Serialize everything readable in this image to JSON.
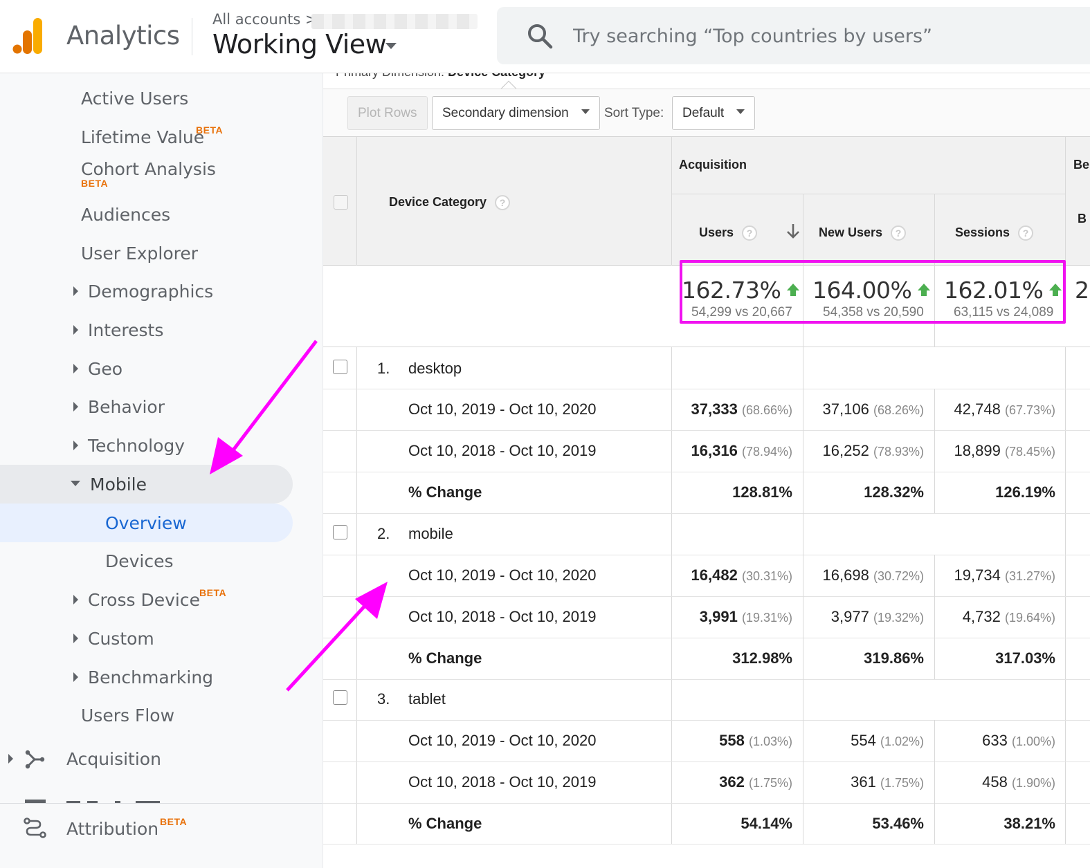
{
  "header": {
    "app_name": "Analytics",
    "breadcrumb": "All accounts",
    "view_name": "Working View",
    "search_placeholder": "Try searching “Top countries by users”"
  },
  "sidebar": {
    "items": [
      {
        "label": "Active Users"
      },
      {
        "label": "Lifetime Value",
        "badge": "BETA"
      },
      {
        "label": "Cohort Analysis",
        "badge": "BETA"
      },
      {
        "label": "Audiences"
      },
      {
        "label": "User Explorer"
      },
      {
        "label": "Demographics"
      },
      {
        "label": "Interests"
      },
      {
        "label": "Geo"
      },
      {
        "label": "Behavior"
      },
      {
        "label": "Technology"
      },
      {
        "label": "Mobile"
      },
      {
        "label": "Overview"
      },
      {
        "label": "Devices"
      },
      {
        "label": "Cross Device",
        "badge": "BETA"
      },
      {
        "label": "Custom"
      },
      {
        "label": "Benchmarking"
      },
      {
        "label": "Users Flow"
      },
      {
        "label": "Acquisition"
      },
      {
        "label": "Attribution",
        "badge": "BETA"
      }
    ]
  },
  "toolbar": {
    "primary_dimension_label": "Primary Dimension:",
    "primary_dimension_value": "Device Category",
    "plot_rows": "Plot Rows",
    "secondary_dimension": "Secondary dimension",
    "sort_type_label": "Sort Type:",
    "sort_type_value": "Default"
  },
  "table": {
    "dimension_header": "Device Category",
    "group_header": "Acquisition",
    "next_group_header_partial": "Be",
    "next_col_partial": "B",
    "columns": [
      "Users",
      "New Users",
      "Sessions"
    ],
    "totals": [
      {
        "pct": "162.73%",
        "compare": "54,299 vs 20,667"
      },
      {
        "pct": "164.00%",
        "compare": "54,358 vs 20,590"
      },
      {
        "pct": "162.01%",
        "compare": "63,115 vs 24,089"
      }
    ],
    "totals_partial_next": "2",
    "groups": [
      {
        "index": "1.",
        "name": "desktop",
        "rows": [
          {
            "label": "Oct 10, 2019 - Oct 10, 2020",
            "users": "37,333",
            "users_pct": "(68.66%)",
            "new_users": "37,106",
            "new_users_pct": "(68.26%)",
            "sessions": "42,748",
            "sessions_pct": "(67.73%)"
          },
          {
            "label": "Oct 10, 2018 - Oct 10, 2019",
            "users": "16,316",
            "users_pct": "(78.94%)",
            "new_users": "16,252",
            "new_users_pct": "(78.93%)",
            "sessions": "18,899",
            "sessions_pct": "(78.45%)"
          },
          {
            "label": "% Change",
            "users": "128.81%",
            "new_users": "128.32%",
            "sessions": "126.19%"
          }
        ]
      },
      {
        "index": "2.",
        "name": "mobile",
        "rows": [
          {
            "label": "Oct 10, 2019 - Oct 10, 2020",
            "users": "16,482",
            "users_pct": "(30.31%)",
            "new_users": "16,698",
            "new_users_pct": "(30.72%)",
            "sessions": "19,734",
            "sessions_pct": "(31.27%)"
          },
          {
            "label": "Oct 10, 2018 - Oct 10, 2019",
            "users": "3,991",
            "users_pct": "(19.31%)",
            "new_users": "3,977",
            "new_users_pct": "(19.32%)",
            "sessions": "4,732",
            "sessions_pct": "(19.64%)"
          },
          {
            "label": "% Change",
            "users": "312.98%",
            "new_users": "319.86%",
            "sessions": "317.03%"
          }
        ]
      },
      {
        "index": "3.",
        "name": "tablet",
        "rows": [
          {
            "label": "Oct 10, 2019 - Oct 10, 2020",
            "users": "558",
            "users_pct": "(1.03%)",
            "new_users": "554",
            "new_users_pct": "(1.02%)",
            "sessions": "633",
            "sessions_pct": "(1.00%)"
          },
          {
            "label": "Oct 10, 2018 - Oct 10, 2019",
            "users": "362",
            "users_pct": "(1.75%)",
            "new_users": "361",
            "new_users_pct": "(1.75%)",
            "sessions": "458",
            "sessions_pct": "(1.90%)"
          },
          {
            "label": "% Change",
            "users": "54.14%",
            "new_users": "53.46%",
            "sessions": "38.21%"
          }
        ]
      }
    ]
  },
  "colors": {
    "highlight": "#f013f0",
    "annotation_arrow": "#ff00ff",
    "positive_arrow": "#4caf50",
    "active_nav": "#1967d2",
    "beta": "#e8710a"
  }
}
